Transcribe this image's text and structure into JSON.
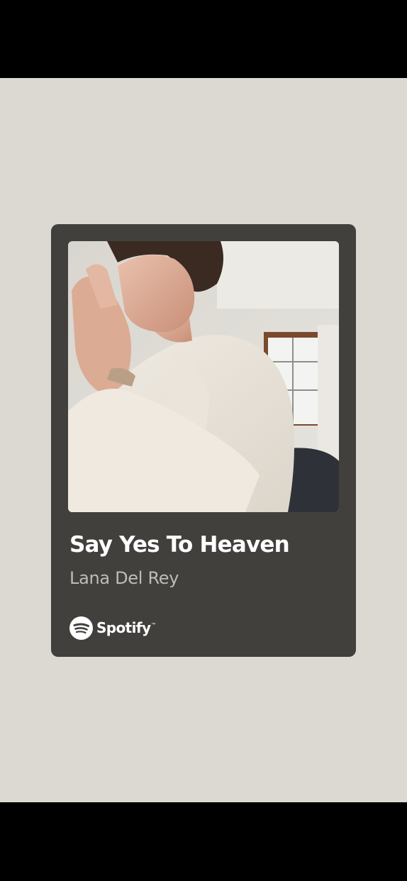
{
  "share_card": {
    "track_title": "Say Yes To Heaven",
    "artist_name": "Lana Del Rey",
    "brand_name": "Spotify",
    "brand_icon": "spotify-logo-icon",
    "cover_image": "album-cover-photo"
  },
  "colors": {
    "background": "#dcd9d2",
    "card": "#41403d",
    "title_text": "#ffffff",
    "artist_text": "#bdbcb7",
    "system_bars": "#000000"
  }
}
